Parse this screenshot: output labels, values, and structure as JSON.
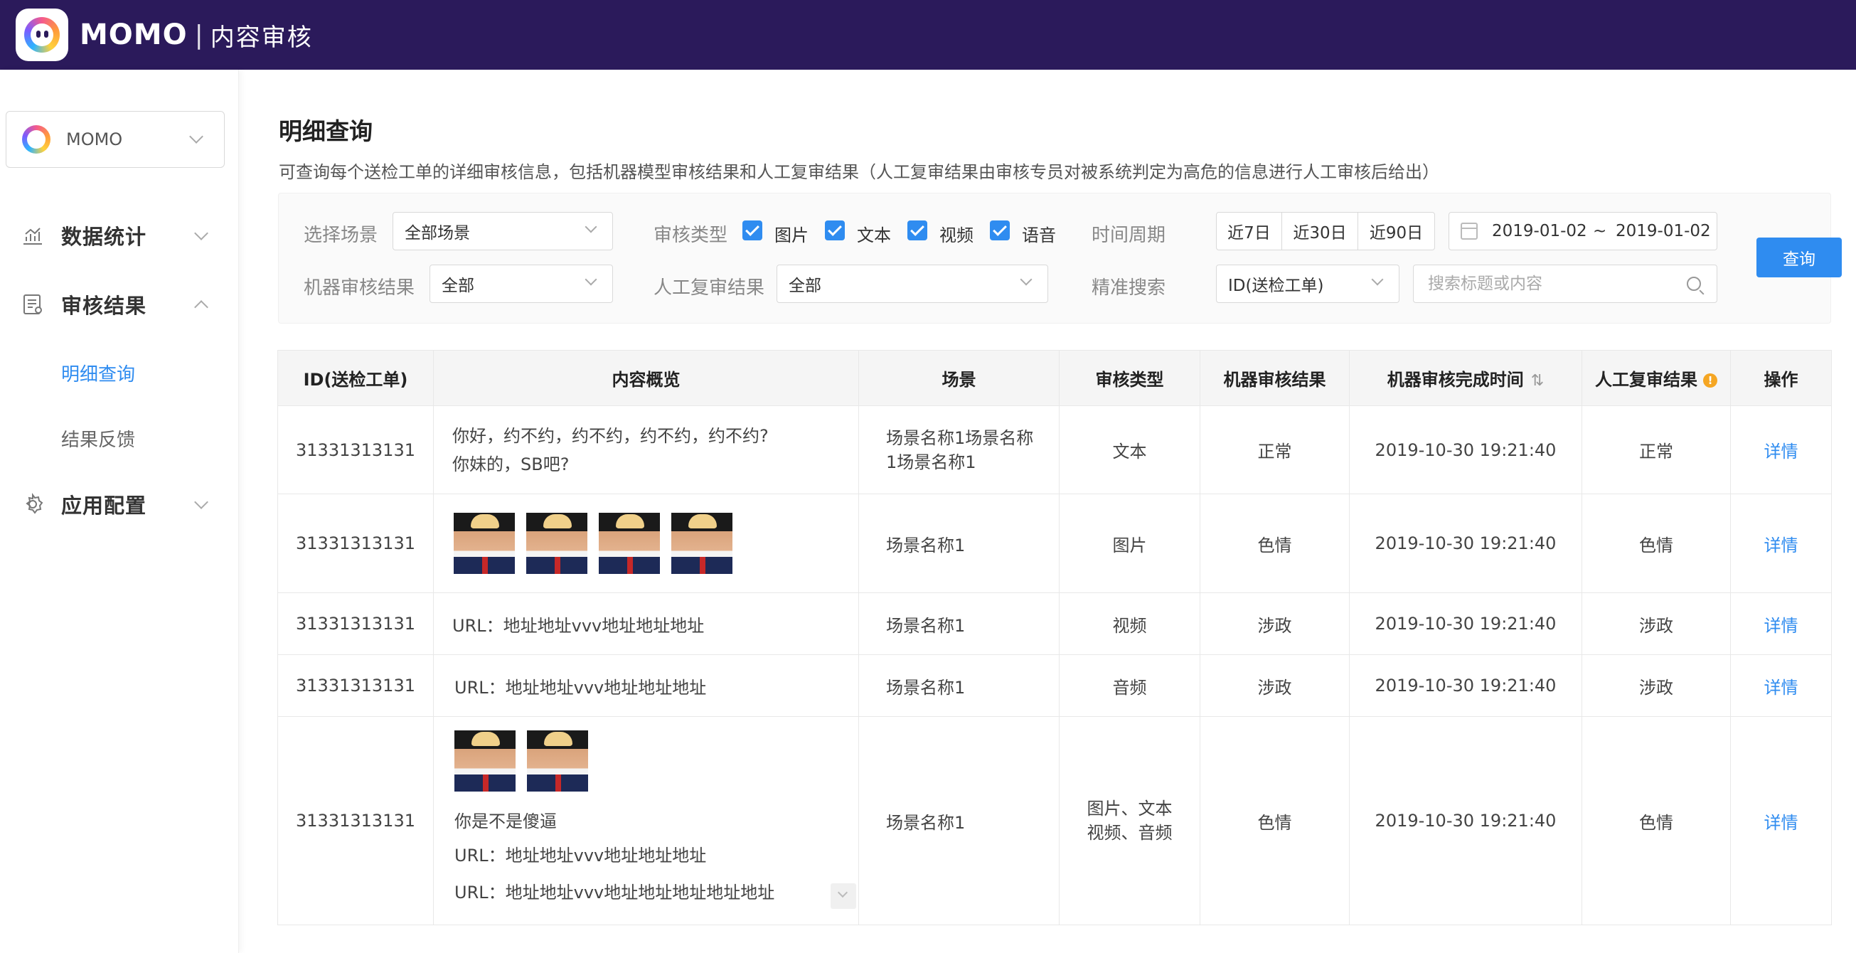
{
  "header": {
    "brand": "MOMO",
    "separator": "|",
    "subtitle": "内容审核"
  },
  "sidebar": {
    "app_select": {
      "label": "MOMO"
    },
    "nav": [
      {
        "label": "数据统计",
        "expanded": false
      },
      {
        "label": "审核结果",
        "expanded": true,
        "children": [
          {
            "label": "明细查询",
            "active": true
          },
          {
            "label": "结果反馈",
            "active": false
          }
        ]
      },
      {
        "label": "应用配置",
        "expanded": false
      }
    ]
  },
  "page": {
    "title": "明细查询",
    "description": "可查询每个送检工单的详细审核信息，包括机器模型审核结果和人工复审结果（人工复审结果由审核专员对被系统判定为高危的信息进行人工审核后给出）"
  },
  "filters": {
    "scene_label": "选择场景",
    "scene_value": "全部场景",
    "type_label": "审核类型",
    "types": [
      {
        "label": "图片",
        "checked": true
      },
      {
        "label": "文本",
        "checked": true
      },
      {
        "label": "视频",
        "checked": true
      },
      {
        "label": "语音",
        "checked": true
      }
    ],
    "period_label": "时间周期",
    "periods": [
      "近7日",
      "近30日",
      "近90日"
    ],
    "date_start": "2019-01-02",
    "date_sep": "~",
    "date_end": "2019-01-02",
    "machine_label": "机器审核结果",
    "machine_value": "全部",
    "manual_label": "人工复审结果",
    "manual_value": "全部",
    "precise_label": "精准搜索",
    "precise_field": "ID(送检工单)",
    "search_placeholder": "搜索标题或内容",
    "query_button": "查询"
  },
  "table": {
    "columns": [
      "ID(送检工单)",
      "内容概览",
      "场景",
      "审核类型",
      "机器审核结果",
      "机器审核完成时间",
      "人工复审结果",
      "操作"
    ],
    "sort_icon": "⇅",
    "warn_icon": "!",
    "rows": [
      {
        "id": "31331313131",
        "content_lines": [
          "你好，约不约，约不约，约不约，约不约?",
          "你妹的，SB吧?"
        ],
        "images": 0,
        "scene_lines": [
          "场景名称1场景名称",
          "1场景名称1"
        ],
        "type_lines": [
          "文本"
        ],
        "machine": "正常",
        "time": "2019-10-30 19:21:40",
        "manual": "正常",
        "action": "详情"
      },
      {
        "id": "31331313131",
        "content_lines": [],
        "images": 4,
        "scene_lines": [
          "场景名称1"
        ],
        "type_lines": [
          "图片"
        ],
        "machine": "色情",
        "time": "2019-10-30 19:21:40",
        "manual": "色情",
        "action": "详情"
      },
      {
        "id": "31331313131",
        "content_lines": [
          "URL：地址地址vvv地址地址地址"
        ],
        "images": 0,
        "scene_lines": [
          "场景名称1"
        ],
        "type_lines": [
          "视频"
        ],
        "machine": "涉政",
        "time": "2019-10-30 19:21:40",
        "manual": "涉政",
        "action": "详情"
      },
      {
        "id": "31331313131",
        "content_lines": [
          "URL：地址地址vvv地址地址地址"
        ],
        "images": 0,
        "scene_lines": [
          "场景名称1"
        ],
        "type_lines": [
          "音频"
        ],
        "machine": "涉政",
        "time": "2019-10-30 19:21:40",
        "manual": "涉政",
        "action": "详情"
      },
      {
        "id": "31331313131",
        "content_lines": [
          "你是不是傻逼",
          "URL：地址地址vvv地址地址地址",
          "URL：地址地址vvv地址地址地址地址地址"
        ],
        "images": 2,
        "scene_lines": [
          "场景名称1"
        ],
        "type_lines": [
          "图片、文本",
          "视频、音频"
        ],
        "machine": "色情",
        "time": "2019-10-30 19:21:40",
        "manual": "色情",
        "action": "详情"
      }
    ]
  },
  "colors": {
    "topbar": "#2b1a5b",
    "accent": "#2f8cf0",
    "warn": "#f5a623"
  }
}
